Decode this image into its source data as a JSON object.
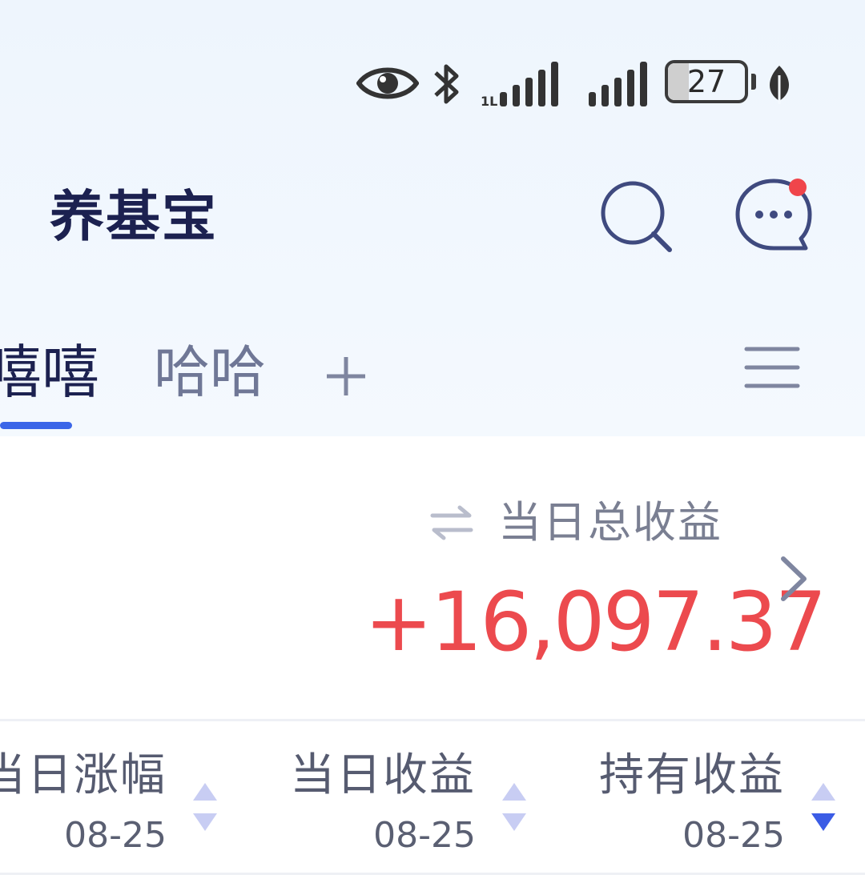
{
  "status_bar": {
    "battery_level": "27",
    "battery_fraction": 0.27,
    "icons": [
      "eye-icon",
      "bluetooth-icon",
      "signal-hd-icon",
      "signal-icon",
      "battery-icon",
      "leaf-icon"
    ]
  },
  "header": {
    "title": "养基宝",
    "icons": [
      "search-icon",
      "message-icon"
    ],
    "notification_dot_color": "#f0454b"
  },
  "tabs": {
    "items": [
      {
        "label": "嘻嘻",
        "active": true
      },
      {
        "label": "哈哈",
        "active": false
      }
    ],
    "add_icon": "plus-icon",
    "menu_icon": "menu-icon",
    "active_color": "#3b66e8"
  },
  "summary": {
    "label": "当日总收益",
    "value": "+16,097.37",
    "value_color": "#ec4a4e",
    "swap_icon": "swap-arrows-icon",
    "chevron_icon": "chevron-right-icon"
  },
  "columns": [
    {
      "label": "当日涨幅",
      "date": "08-25",
      "sort": "none"
    },
    {
      "label": "当日收益",
      "date": "08-25",
      "sort": "none"
    },
    {
      "label": "持有收益",
      "date": "08-25",
      "sort": "desc"
    }
  ],
  "colors": {
    "sort_inactive": "#c8cdf3",
    "sort_active": "#3b5ce5"
  }
}
